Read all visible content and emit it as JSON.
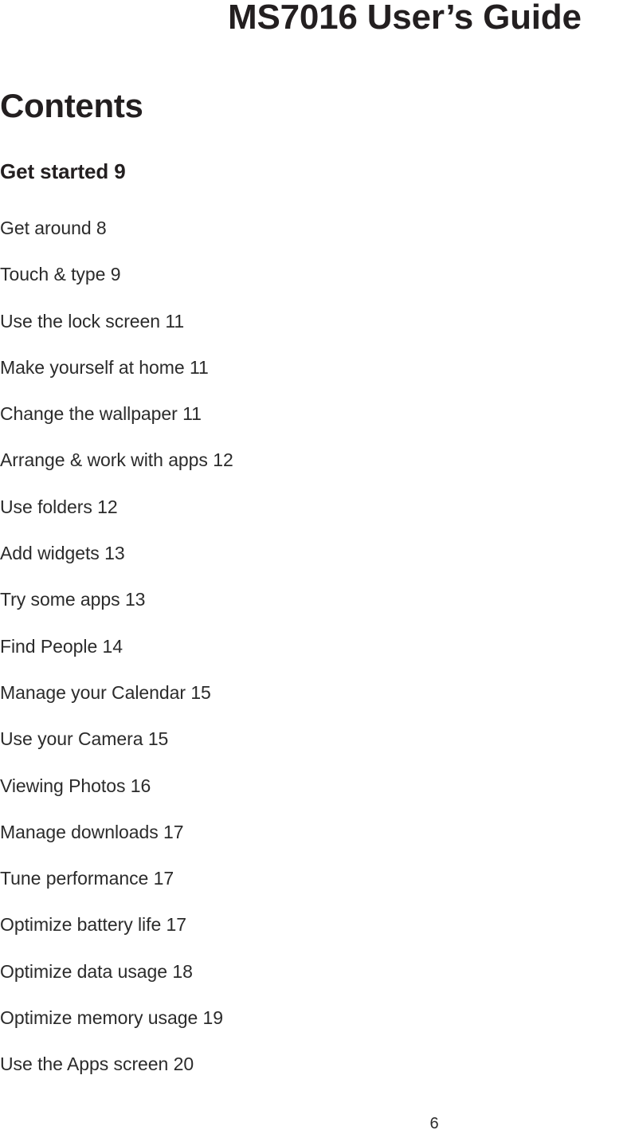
{
  "document": {
    "header_title": "MS7016 User’s Guide",
    "page_number": "6"
  },
  "contents": {
    "heading": "Contents",
    "section_heading": "Get started 9",
    "entries": [
      {
        "label": "Get around 8"
      },
      {
        "label": "Touch & type 9"
      },
      {
        "label": "Use the lock screen 11"
      },
      {
        "label": "Make yourself at home 11"
      },
      {
        "label": "Change the wallpaper 11"
      },
      {
        "label": "Arrange & work with apps 12"
      },
      {
        "label": "Use folders 12"
      },
      {
        "label": "Add widgets 13"
      },
      {
        "label": "Try some apps 13"
      },
      {
        "label": "Find People 14"
      },
      {
        "label": "Manage your Calendar 15"
      },
      {
        "label": "Use your Camera 15"
      },
      {
        "label": "Viewing Photos 16"
      },
      {
        "label": "Manage downloads 17"
      },
      {
        "label": "Tune performance 17"
      },
      {
        "label": "Optimize battery life 17"
      },
      {
        "label": "Optimize data usage 18"
      },
      {
        "label": "Optimize memory usage 19"
      },
      {
        "label": "Use the Apps screen 20"
      }
    ]
  },
  "theme": {
    "page_background": "#ffffff",
    "text_color": "#231f20",
    "body_text_color": "#2b2b2b"
  }
}
